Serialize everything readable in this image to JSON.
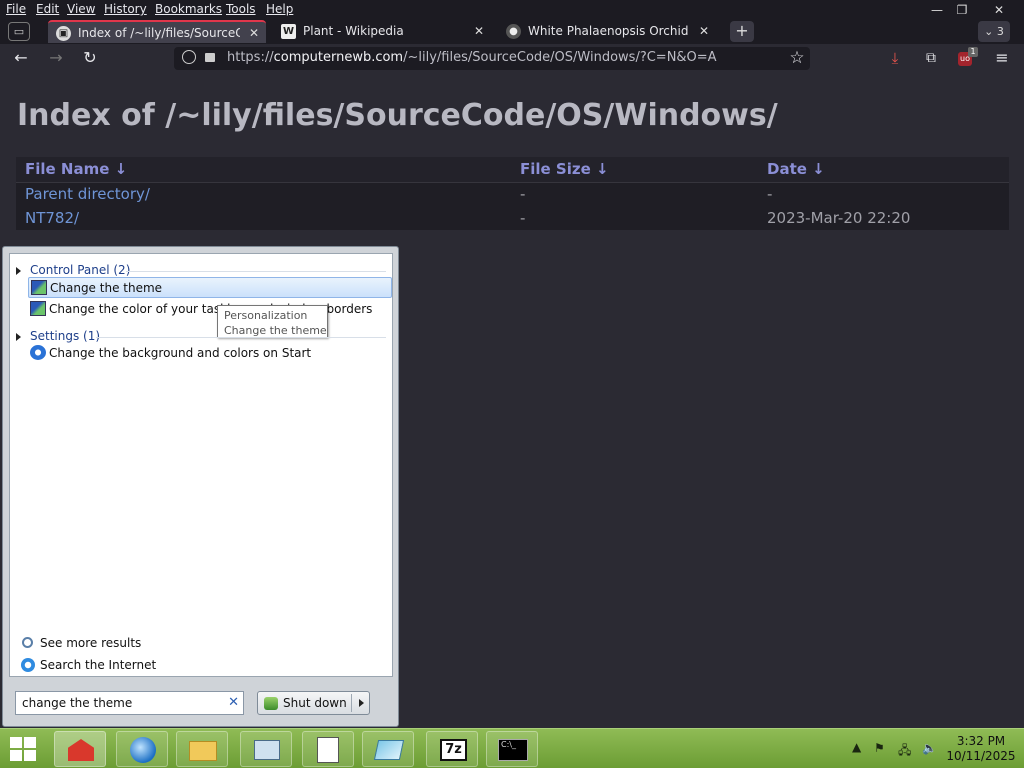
{
  "menubar": {
    "items": [
      "File",
      "Edit",
      "View",
      "History",
      "Bookmarks",
      "Tools",
      "Help"
    ]
  },
  "tabs": [
    {
      "title": "Index of /~lily/files/SourceCode",
      "favicon": "computer-favicon"
    },
    {
      "title": "Plant - Wikipedia",
      "favicon": "wikipedia-favicon"
    },
    {
      "title": "White Phalaenopsis Orchid Garde",
      "favicon": "orchid-favicon"
    }
  ],
  "tab_list_count": "3",
  "urlbar": {
    "prefix": "https://",
    "domain": "computernewb.com",
    "path": "/~lily/files/SourceCode/OS/Windows/?C=N&O=A"
  },
  "extension_badge": "1",
  "page": {
    "title": "Index of /~lily/files/SourceCode/OS/Windows/",
    "columns": [
      "File Name  ↓",
      "File Size  ↓",
      "Date  ↓"
    ],
    "rows": [
      {
        "name": "Parent directory/",
        "size": "-",
        "date": "-"
      },
      {
        "name": "NT782/",
        "size": "-",
        "date": "2023-Mar-20 22:20"
      }
    ]
  },
  "startmenu": {
    "group_control_panel": "Control Panel (2)",
    "result_change_theme": "Change the theme",
    "result_taskbar_color": "Change the color of your taskbar and window borders",
    "tooltip_line1": "Personalization",
    "tooltip_line2": "Change the theme",
    "group_settings": "Settings (1)",
    "result_background": "Change the background and colors on Start",
    "see_more": "See more results",
    "search_internet": "Search the Internet",
    "search_value": "change the theme",
    "shutdown_label": "Shut down"
  },
  "clock": {
    "time": "3:32 PM",
    "date": "10/11/2025"
  },
  "colors": {
    "page_bg": "#2b2a33",
    "link": "#6f95d6",
    "header": "#8b8fd6",
    "taskbar": "#7fab45"
  }
}
